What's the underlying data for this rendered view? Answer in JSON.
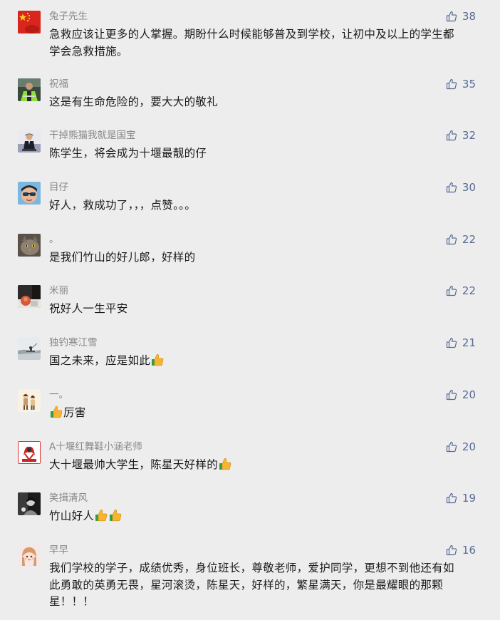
{
  "comments": [
    {
      "user": "兔子先生",
      "text_lines": [
        "急救应该让更多的人掌握。期盼什么时候能够普及到学校，让初中及以上的学生都",
        "学会急救措施。"
      ],
      "likes": "38",
      "avatar": "china-flag-avatar"
    },
    {
      "user": "祝福",
      "text_lines": [
        "这是有生命危险的，要大大的敬礼"
      ],
      "likes": "35",
      "avatar": "green-jacket-avatar"
    },
    {
      "user": "干掉熊猫我就是国宝",
      "text_lines": [
        "陈学生，将会成为十堰最靓的仔"
      ],
      "likes": "32",
      "avatar": "suit-man-avatar"
    },
    {
      "user": "目仔",
      "text_lines": [
        "好人，救成功了，，，点赞。。。"
      ],
      "likes": "30",
      "avatar": "sunglasses-avatar"
    },
    {
      "user": "。",
      "text_lines": [
        "是我们竹山的好儿郎，好样的"
      ],
      "likes": "22",
      "avatar": "cat-avatar"
    },
    {
      "user": "米丽",
      "text_lines": [
        "祝好人一生平安"
      ],
      "likes": "22",
      "avatar": "dark-photo-avatar"
    },
    {
      "user": "独钓寒江雪",
      "text_lines": [
        "国之未来，应是如此"
      ],
      "likes": "21",
      "avatar": "snow-landscape-avatar",
      "emoji_after": 1
    },
    {
      "user": "一。",
      "text_lines": [
        "厉害"
      ],
      "likes": "20",
      "avatar": "cartoon-figures-avatar",
      "emoji_before": 1
    },
    {
      "user": "A十堰红舞鞋小涵老师",
      "text_lines": [
        "大十堰最帅大学生，陈星天好样的"
      ],
      "likes": "20",
      "avatar": "red-logo-avatar",
      "emoji_after": 1
    },
    {
      "user": "笑揖清风",
      "text_lines": [
        "竹山好人"
      ],
      "likes": "19",
      "avatar": "bw-photo-avatar",
      "emoji_after": 2
    },
    {
      "user": "早早",
      "text_lines": [
        "我们学校的学子，成绩优秀，身位班长，尊敬老师，爱护同学，更想不到他还有如",
        "此勇敢的英勇无畏，星河滚烫，陈星天，好样的，繁星满天，你是最耀眼的那颗",
        "星！！！"
      ],
      "likes": "16",
      "avatar": "girl-anime-avatar"
    }
  ],
  "colors": {
    "background": "#ededed",
    "username": "#888888",
    "text": "#1a1a1a",
    "like": "#576b95"
  },
  "icons": {
    "like": "thumbs-up-outline-icon",
    "emoji": "thumbs-up-emoji"
  }
}
